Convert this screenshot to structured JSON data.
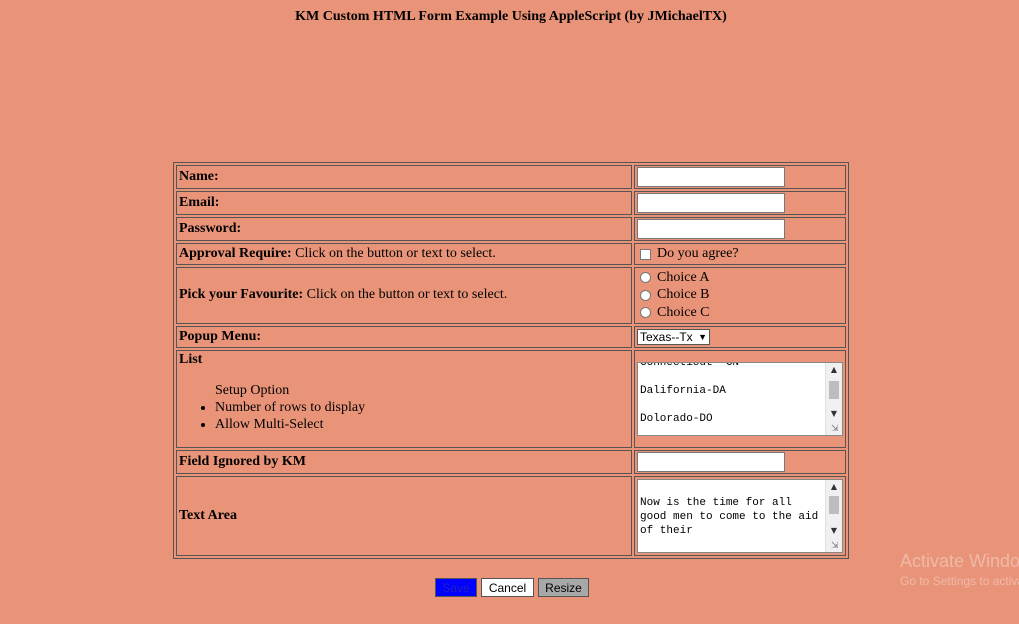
{
  "page": {
    "title": "KM Custom HTML Form Example Using AppleScript (by JMichaelTX)"
  },
  "form": {
    "name_label": "Name:",
    "name_value": "",
    "email_label": "Email:",
    "email_value": "",
    "password_label": "Password:",
    "password_value": "",
    "approval_label": "Approval Require:",
    "approval_desc": " Click on the button or text to select.",
    "approval_checkbox_label": "Do you agree?",
    "approval_checked": false,
    "favourite_label": "Pick your Favourite:",
    "favourite_desc": " Click on the button or text to select.",
    "choices": [
      "Choice A",
      "Choice B",
      "Choice C"
    ],
    "popup_label": "Popup Menu:",
    "popup_selected": "Texas--Tx",
    "list_label": "List",
    "list_setup": "Setup Option",
    "list_options": [
      "Number of rows to display",
      "Allow Multi-Select"
    ],
    "list_items": [
      "Connecticut--CN",
      "Dalifornia-DA",
      "Dolorado-DO"
    ],
    "ignored_label": "Field Ignored by KM",
    "ignored_value": "",
    "textarea_label": "Text Area",
    "textarea_value": "Now is the time for all good men to come to the aid of their"
  },
  "buttons": {
    "save": "Save",
    "cancel": "Cancel",
    "resize": "Resize"
  },
  "watermark": {
    "line1": "Activate Windows",
    "line2": "Go to Settings to activate Windows."
  }
}
